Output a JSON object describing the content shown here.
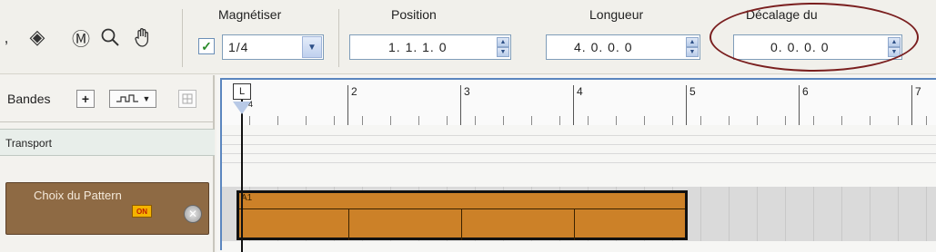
{
  "toolbar": {
    "tools": [
      {
        "name": "pencil-tool-partial",
        "glyph": "‚"
      },
      {
        "name": "eraser-tool",
        "glyph": "◈"
      },
      {
        "name": "mute-tool",
        "glyph": "Ⓜ"
      },
      {
        "name": "magnify-tool",
        "glyph": "🔍"
      },
      {
        "name": "hand-tool",
        "glyph": "✋"
      }
    ],
    "snap": {
      "label": "Magnétiser",
      "checked": true,
      "value": "1/4"
    },
    "position": {
      "label": "Position",
      "value": "1. 1. 1.   0"
    },
    "length": {
      "label": "Longueur",
      "value": "4. 0. 0.   0"
    },
    "offset": {
      "label": "Décalage du",
      "value": "0. 0. 0.   0"
    }
  },
  "tracks": {
    "header_label": "Bandes",
    "add_button": "+",
    "transport_label": "Transport",
    "pattern_label": "Choix du Pattern",
    "on_badge": "ON",
    "remove_glyph": "✕"
  },
  "ruler": {
    "bars": [
      "2",
      "3",
      "4",
      "5",
      "6",
      "7"
    ],
    "locator_flag": "L",
    "locator_sub": "4"
  },
  "clip": {
    "label": "A1"
  },
  "colors": {
    "accent_blue": "#5b86bf",
    "pattern_track": "#8e6a44",
    "clip_fill": "#cc8128",
    "annotation_ellipse": "#7a1f1f"
  }
}
